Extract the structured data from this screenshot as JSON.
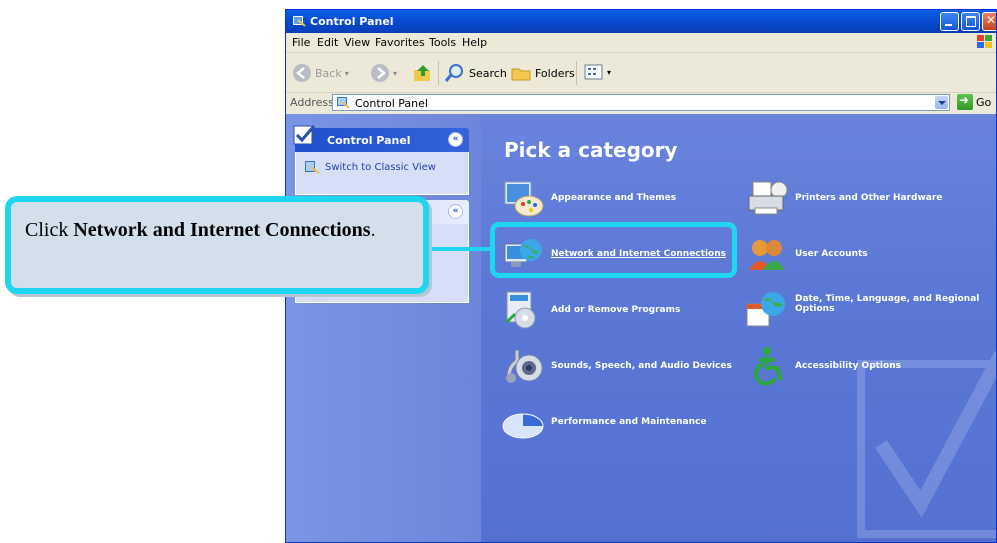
{
  "window": {
    "title": "Control Panel"
  },
  "menu": [
    "File",
    "Edit",
    "View",
    "Favorites",
    "Tools",
    "Help"
  ],
  "toolbar": {
    "back": "Back",
    "search": "Search",
    "folders": "Folders"
  },
  "address": {
    "label": "Address",
    "value": "Control Panel",
    "go": "Go"
  },
  "sidebar": {
    "panel_title": "Control Panel",
    "switch_link": "Switch to Classic View"
  },
  "main": {
    "heading": "Pick a category",
    "categories": [
      {
        "label": "Appearance and Themes",
        "icon": "appearance-icon"
      },
      {
        "label": "Printers and Other Hardware",
        "icon": "printer-icon"
      },
      {
        "label": "Network and Internet Connections",
        "icon": "network-icon"
      },
      {
        "label": "User Accounts",
        "icon": "users-icon"
      },
      {
        "label": "Add or Remove Programs",
        "icon": "programs-icon"
      },
      {
        "label": "Date, Time, Language, and Regional Options",
        "icon": "globe-calendar-icon"
      },
      {
        "label": "Sounds, Speech, and Audio Devices",
        "icon": "audio-icon"
      },
      {
        "label": "Accessibility Options",
        "icon": "accessibility-icon"
      },
      {
        "label": "Performance and Maintenance",
        "icon": "performance-icon"
      }
    ]
  },
  "callout": {
    "prefix": "Click ",
    "bold": "Network and Internet Connections",
    "suffix": "."
  },
  "colors": {
    "highlight": "#1fd6f0",
    "title_bar": "#0a5fe8",
    "pane": "#5c78d6"
  }
}
